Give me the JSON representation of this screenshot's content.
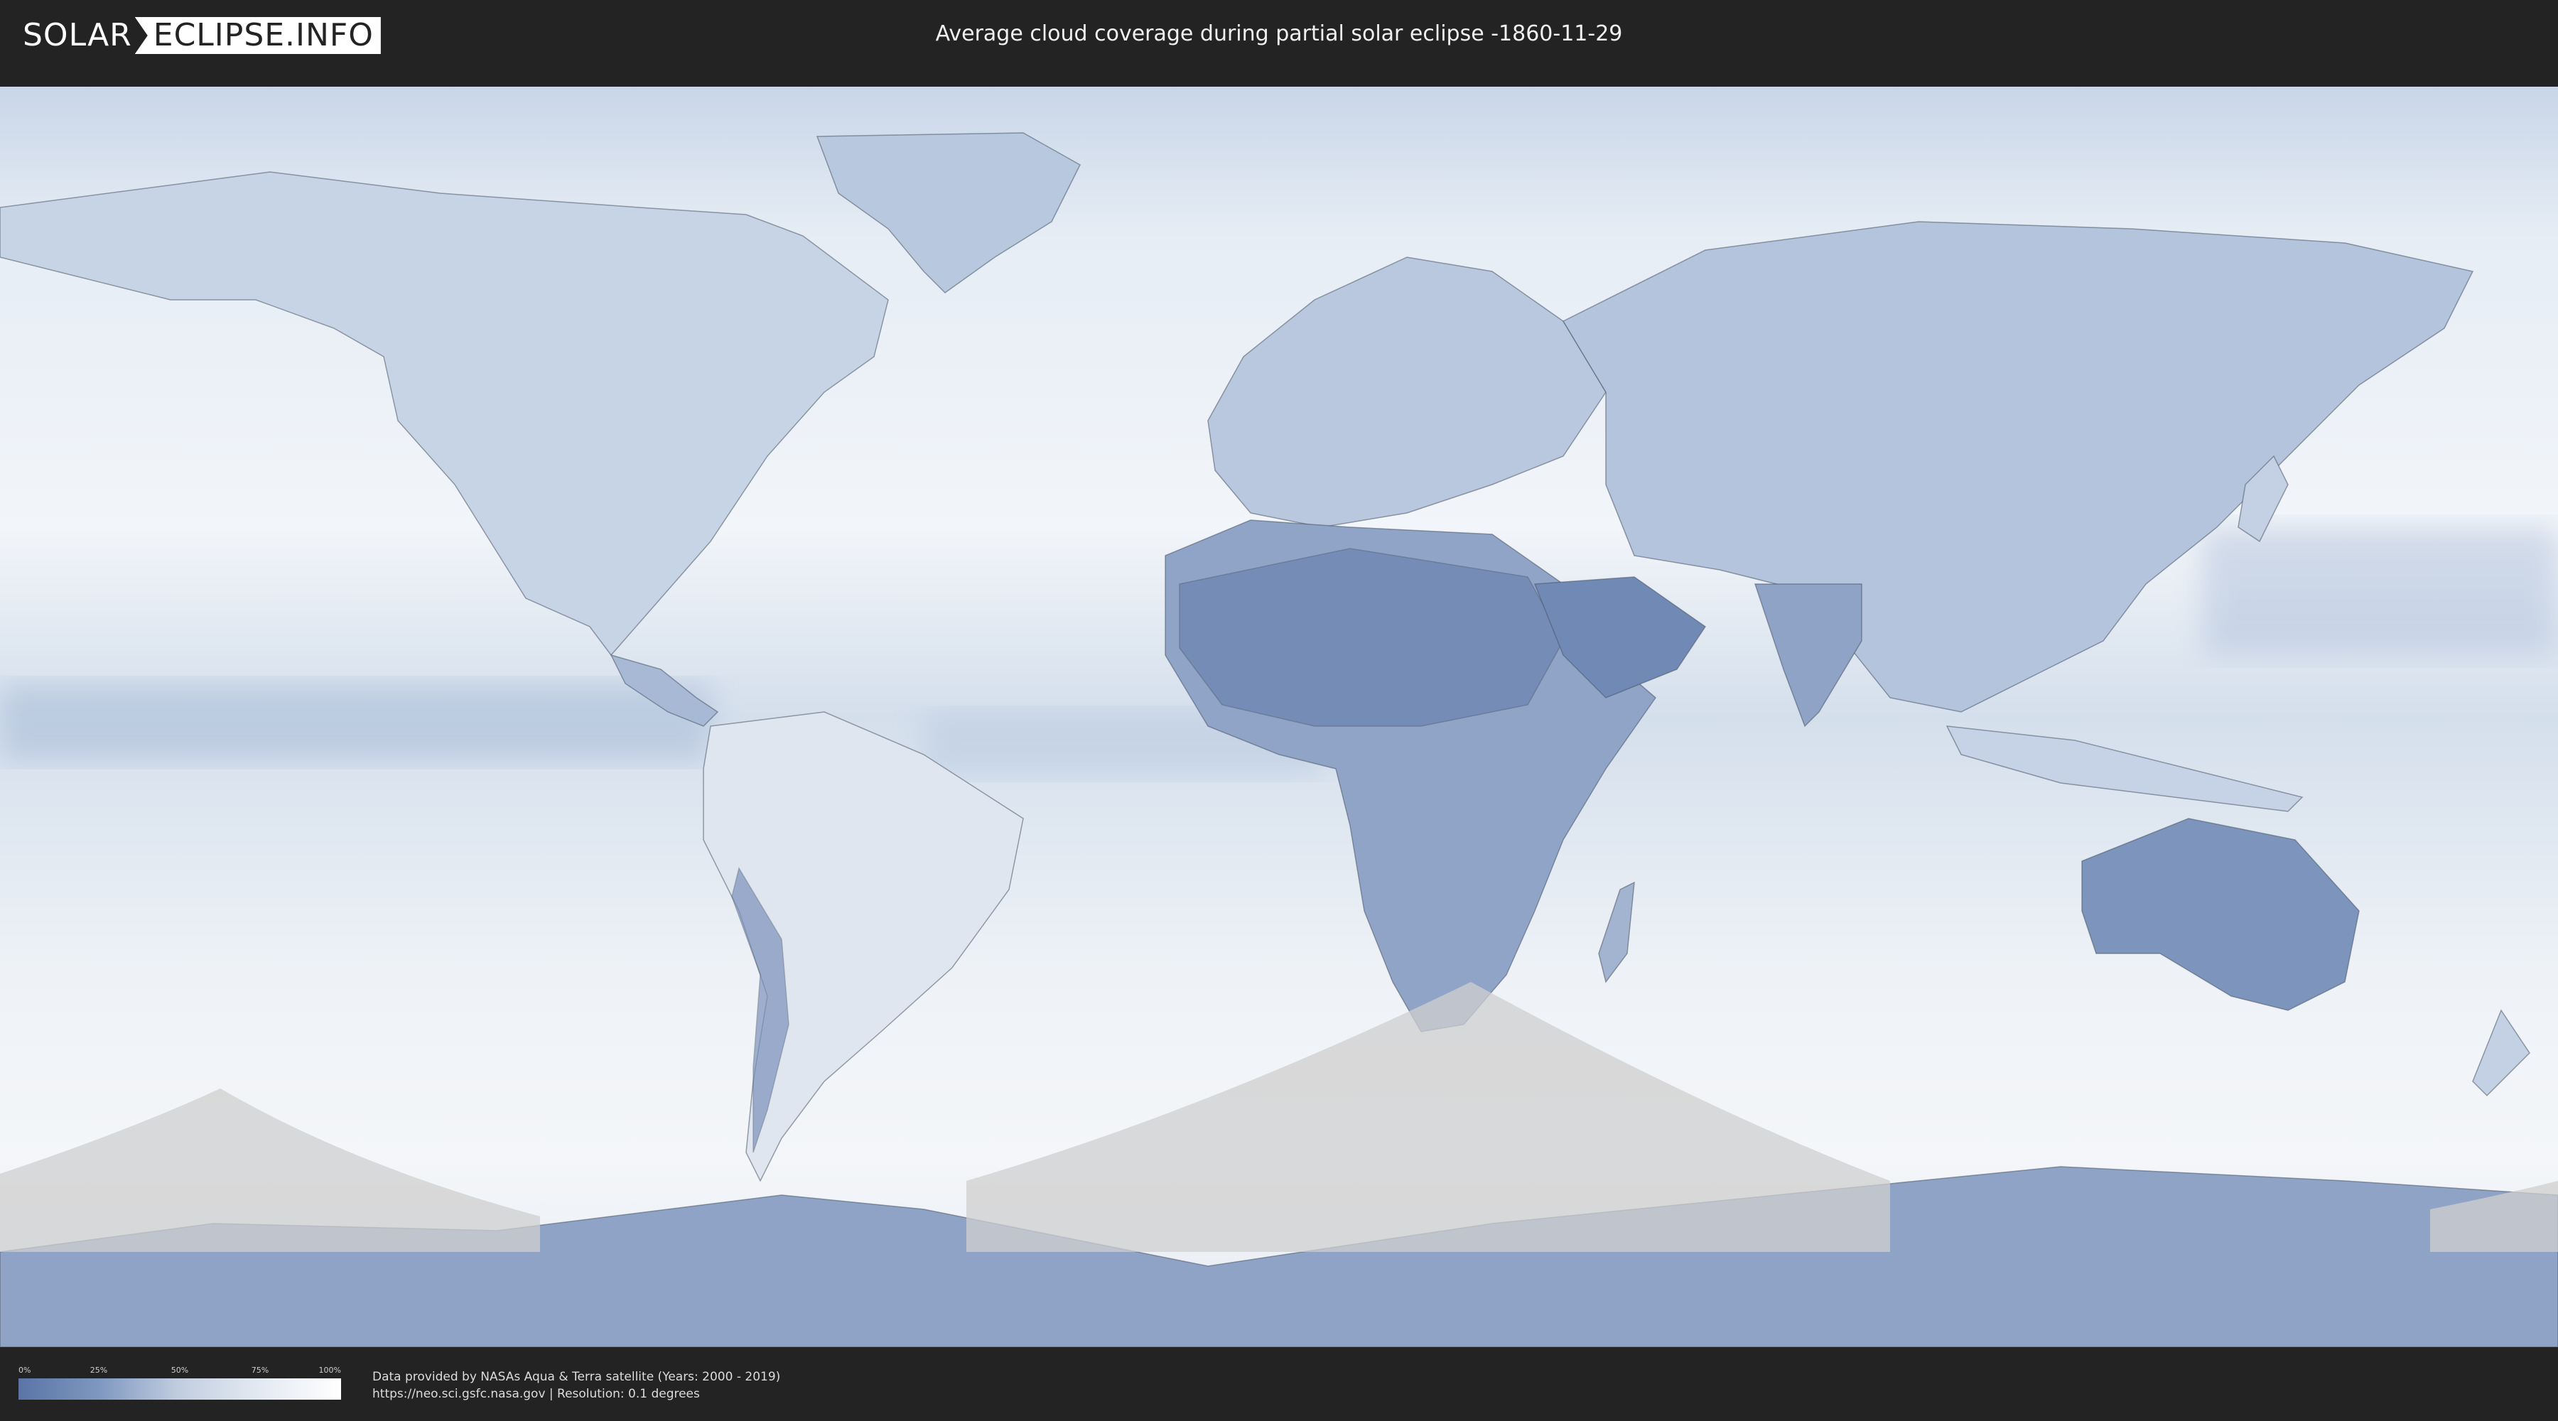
{
  "header": {
    "logo": {
      "left": "SOLAR",
      "right": "ECLIPSE.INFO"
    },
    "title": "Average cloud coverage during partial solar eclipse -1860-11-29"
  },
  "map": {
    "type": "equirectangular world cloud-coverage map",
    "ocean_color": "#dfe8f2",
    "low_cloud_color": "#6f88b6",
    "high_cloud_color": "#ffffff",
    "eclipse_shade_color": "#cfcfcf",
    "border_color": "#4a5566"
  },
  "legend": {
    "ticks": [
      "0%",
      "25%",
      "50%",
      "75%",
      "100%"
    ],
    "gradient": [
      "#5a74a6",
      "#7f98c0",
      "#c2cee0",
      "#e4eaf2",
      "#ffffff"
    ]
  },
  "footer": {
    "line1": "Data provided by NASAs Aqua & Terra satellite (Years: 2000 - 2019)",
    "line2": "https://neo.sci.gsfc.nasa.gov | Resolution: 0.1 degrees"
  }
}
